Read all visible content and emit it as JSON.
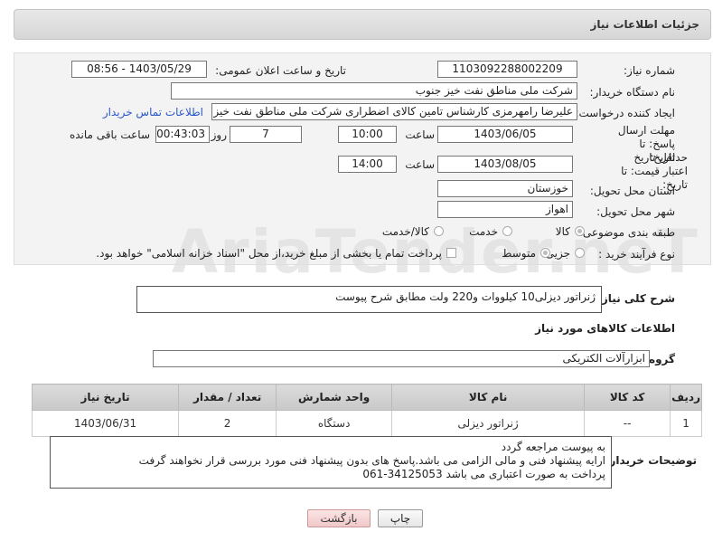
{
  "header": {
    "title": "جزئیات اطلاعات نیاز"
  },
  "form": {
    "need_number_label": "شماره نیاز:",
    "need_number": "1103092288002209",
    "announce_label": "تاریخ و ساعت اعلان عمومی:",
    "announce_value": "1403/05/29 - 08:56",
    "buyer_label": "نام دستگاه خریدار:",
    "buyer_value": "شرکت ملی مناطق نفت خیز جنوب",
    "creator_label": "ایجاد کننده درخواست:",
    "creator_value": "علیرضا رامهرمزی کارشناس تامین کالای اضطراری شرکت ملی مناطق نفت خیز جنوب",
    "contact_link": "اطلاعات تماس خریدار",
    "deadline_label": "مهلت ارسال پاسخ: تا تاریخ:",
    "deadline_date": "1403/06/05",
    "time_label": "ساعت",
    "deadline_time": "10:00",
    "days_value": "7",
    "days_label": "روز و",
    "remaining_time": "00:43:03",
    "remaining_label": "ساعت باقی مانده",
    "validity_label": "حداقل تاریخ اعتبار قیمت: تا تاریخ:",
    "validity_date": "1403/08/05",
    "validity_time_label": "ساعت",
    "validity_time": "14:00",
    "province_label": "استان محل تحویل:",
    "province_value": "خوزستان",
    "city_label": "شهر محل تحویل:",
    "city_value": "اهواز",
    "category_label": "طبقه بندی موضوعی:",
    "category_options": [
      "کالا",
      "خدمت",
      "کالا/خدمت"
    ],
    "process_label": "نوع فرآیند خرید :",
    "process_options": [
      "جزیی",
      "متوسط"
    ],
    "payment_text": "پرداخت تمام یا بخشی از مبلغ خرید،از محل \"اسناد خزانه اسلامی\" خواهد بود."
  },
  "watermark": "AriaTender.neT",
  "description": {
    "label": "شرح کلی نیاز:",
    "value": "ژنراتور دیزلی10 کیلووات و220 ولت مطابق شرح پیوست"
  },
  "goods": {
    "section_title": "اطلاعات کالاهای مورد نیاز",
    "group_label": "گروه کالا:",
    "group_value": "ابزارآلات الکتریکی",
    "columns": [
      "ردیف",
      "کد کالا",
      "نام کالا",
      "واحد شمارش",
      "تعداد / مقدار",
      "تاریخ نیاز"
    ],
    "rows": [
      {
        "row": "1",
        "code": "--",
        "name": "ژنراتور دیزلی",
        "unit": "دستگاه",
        "qty": "2",
        "date": "1403/06/31"
      }
    ]
  },
  "buyer_notes": {
    "label": "توضیحات خریدار:",
    "lines": [
      "به پیوست مراجعه گردد",
      "ارایه پیشنهاد فنی و مالی الزامی می باشد.پاسخ های بدون پیشنهاد فنی مورد بررسی قرار نخواهند گرفت",
      "پرداخت به صورت اعتباری می باشد 34125053-061"
    ]
  },
  "buttons": {
    "print": "چاپ",
    "back": "بازگشت"
  }
}
